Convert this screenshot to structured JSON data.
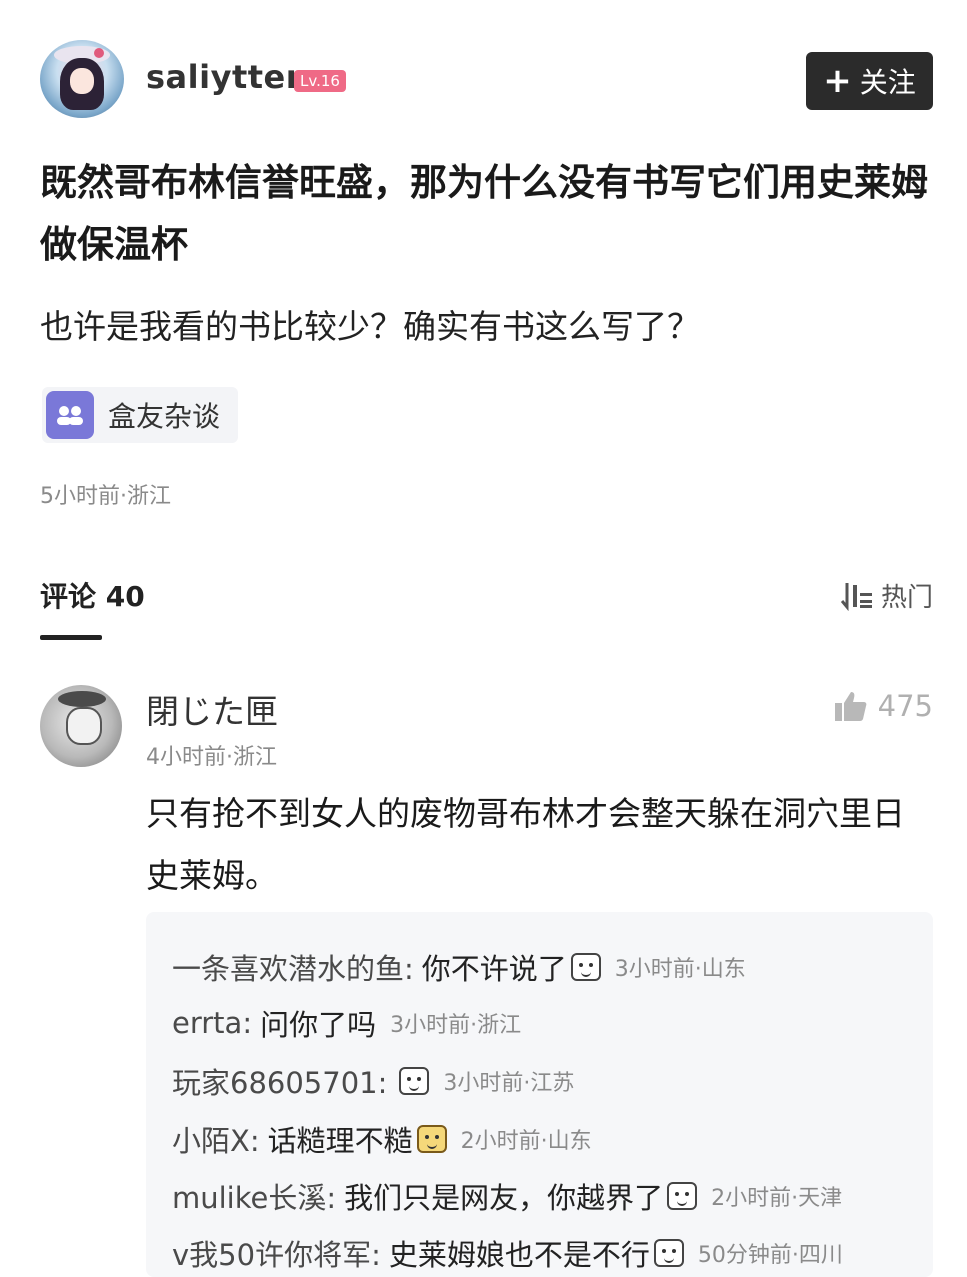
{
  "post": {
    "author": "saliytter",
    "level": "Lv.16",
    "follow_label": "关注",
    "title": "既然哥布林信誉旺盛，那为什么没有书写它们用史莱姆做保温杯",
    "body": "也许是我看的书比较少？确实有书这么写了？",
    "topic": "盒友杂谈",
    "meta": "5小时前·浙江"
  },
  "comments_header": {
    "title": "评论 40",
    "sort": "热门"
  },
  "comment": {
    "author": "閉じた匣",
    "time": "4小时前·浙江",
    "likes": "475",
    "text": "只有抢不到女人的废物哥布林才会整天躲在洞穴里日史莱姆。"
  },
  "replies": [
    {
      "name": "一条喜欢潜水的鱼:",
      "text": "你不许说了",
      "emoji": "crying-face-icon",
      "time": "3小时前·山东"
    },
    {
      "name": "errta:",
      "text": "问你了吗",
      "emoji": "",
      "time": "3小时前·浙江"
    },
    {
      "name": "玩家68605701:",
      "text": "",
      "emoji": "smirk-face-icon",
      "time": "3小时前·江苏"
    },
    {
      "name": "小陌X:",
      "text": "话糙理不糙",
      "emoji": "cat-face-icon",
      "time": "2小时前·山东"
    },
    {
      "name": "mulike长溪:",
      "text": "我们只是网友，你越界了",
      "emoji": "smirk-face-icon",
      "time": "2小时前·天津"
    },
    {
      "name": "v我50许你将军:",
      "text": "史莱姆娘也不是不行",
      "emoji": "grin-face-icon",
      "time": "50分钟前·四川"
    }
  ]
}
